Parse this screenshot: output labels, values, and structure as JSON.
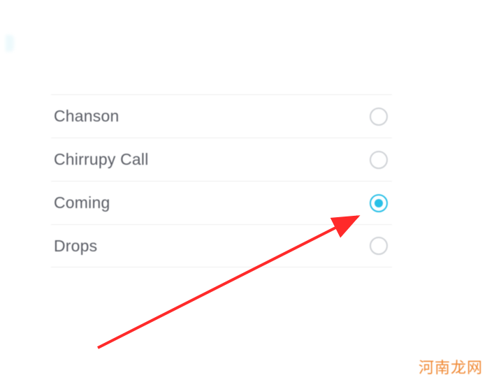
{
  "ringtones": {
    "items": [
      {
        "label": "Chanson",
        "selected": false
      },
      {
        "label": "Chirrupy Call",
        "selected": false
      },
      {
        "label": "Coming",
        "selected": true
      },
      {
        "label": "Drops",
        "selected": false
      }
    ]
  },
  "annotation": {
    "arrow_color": "#ff2a2a"
  },
  "watermark": {
    "text": "河南龙网"
  }
}
